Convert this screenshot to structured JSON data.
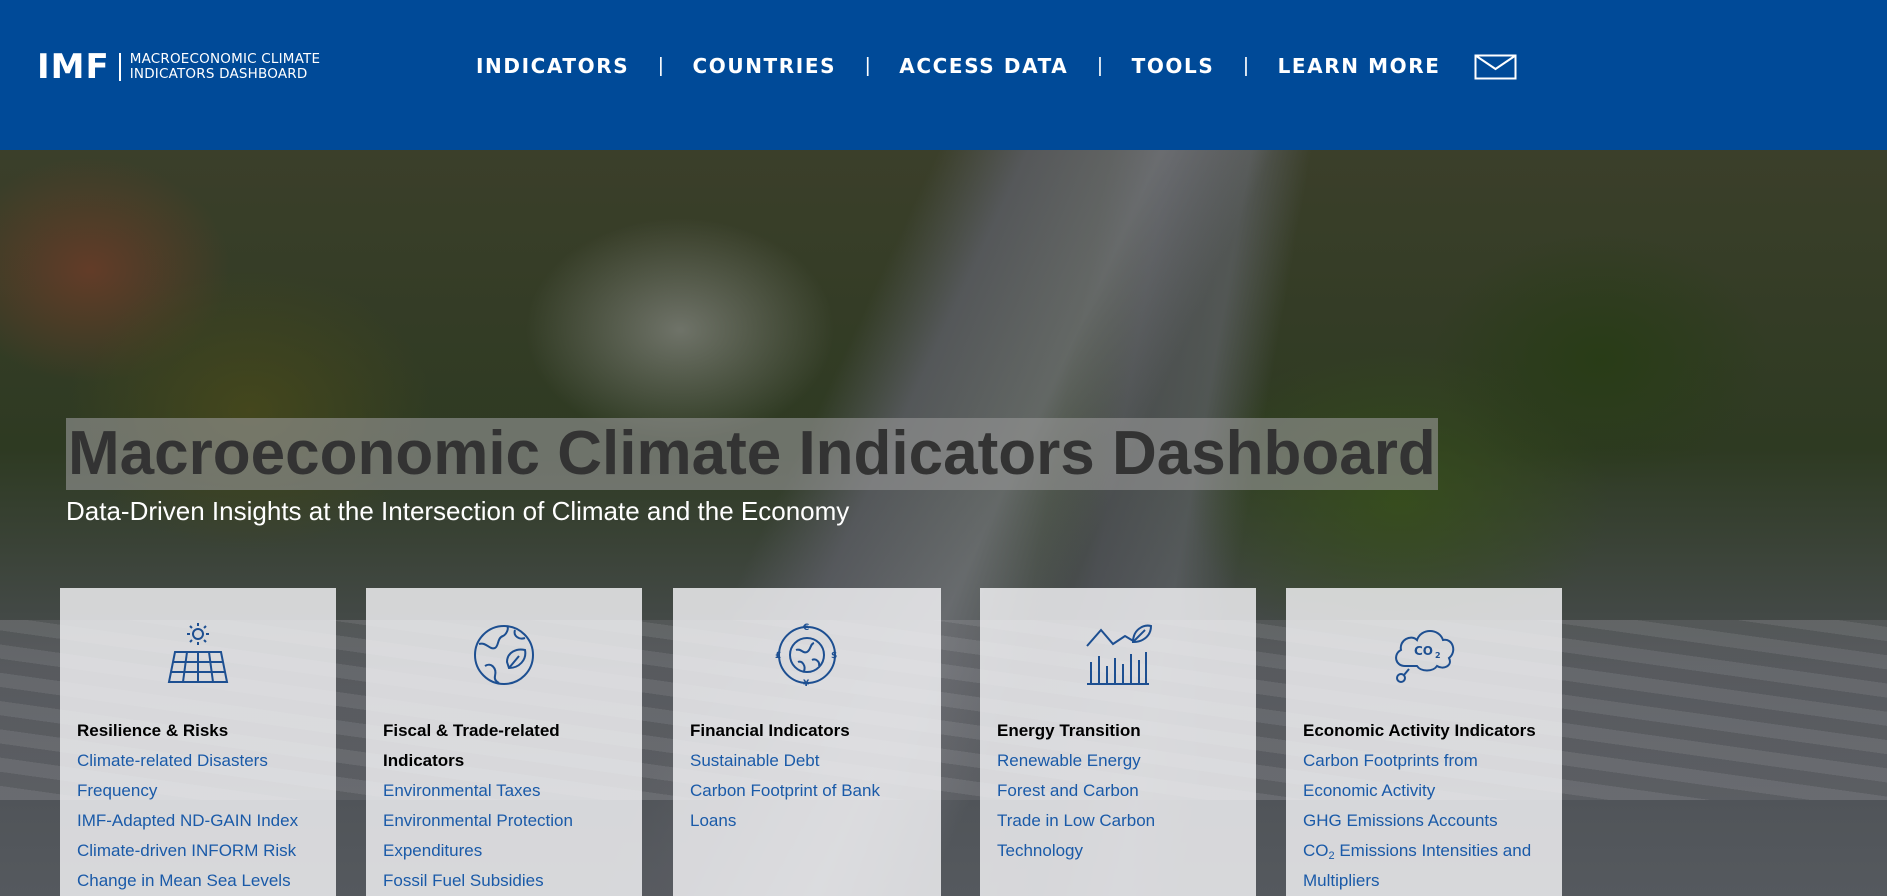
{
  "header": {
    "logo_mark": "IMF",
    "logo_line1": "MACROECONOMIC CLIMATE",
    "logo_line2": "INDICATORS DASHBOARD",
    "nav": [
      {
        "label": "INDICATORS"
      },
      {
        "label": "COUNTRIES"
      },
      {
        "label": "ACCESS DATA"
      },
      {
        "label": "TOOLS"
      },
      {
        "label": "LEARN MORE"
      }
    ],
    "nav_separator": "|",
    "contact_icon": "envelope-icon"
  },
  "hero": {
    "title": "Macroeconomic Climate Indicators Dashboard",
    "subtitle": "Data-Driven Insights at the Intersection of Climate and the Economy"
  },
  "cards": [
    {
      "icon": "solar-panel-icon",
      "title": "Resilience & Risks",
      "links": [
        "Climate-related Disasters Frequency",
        "IMF-Adapted ND-GAIN Index",
        "Climate-driven INFORM Risk",
        "Change in Mean Sea Levels"
      ]
    },
    {
      "icon": "globe-leaf-icon",
      "title": "Fiscal & Trade-related Indicators",
      "links": [
        "Environmental Taxes",
        "Environmental Protection Expenditures",
        "Fossil Fuel Subsidies"
      ]
    },
    {
      "icon": "currency-globe-icon",
      "title": "Financial Indicators",
      "links": [
        "Sustainable Debt",
        "Carbon Footprint of Bank Loans"
      ]
    },
    {
      "icon": "growth-chart-icon",
      "title": "Energy Transition",
      "links": [
        "Renewable Energy",
        "Forest and Carbon",
        "Trade in Low Carbon Technology"
      ]
    },
    {
      "icon": "co2-cloud-icon",
      "title": "Economic Activity Indicators",
      "links": [
        "Carbon Footprints from Economic Activity",
        "GHG Emissions Accounts"
      ],
      "co2_link": {
        "prefix": "CO",
        "sub": "2",
        "suffix": " Emissions Intensities and Multipliers"
      }
    }
  ],
  "colors": {
    "header_bg": "#004a98",
    "link": "#1a5aa8",
    "icon": "#1d4f91"
  }
}
